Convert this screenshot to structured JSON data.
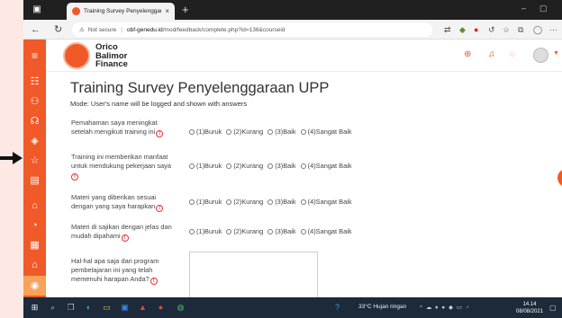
{
  "browser": {
    "tab_title": "Training Survey Penyelenggaraan",
    "tab_close": "×",
    "new_tab": "+",
    "security_label": "Not secure",
    "url_host": "obf-genedu.id",
    "url_path": "/mod/feedback/complete.php?id=136&courseid"
  },
  "site": {
    "logo_lines": [
      "Orico",
      "Balimor",
      "Finance"
    ]
  },
  "page": {
    "title": "Training Survey Penyelenggaraan UPP",
    "mode_note": "Mode: User's name will be logged and shown with answers"
  },
  "questions": [
    {
      "lines": [
        "Pemahaman saya meningkat",
        "setelah mengikuti training ini"
      ],
      "required": true
    },
    {
      "lines": [
        "Training ini memberikan manfaat",
        "untuk mendukung pekerjaan saya"
      ],
      "required": true
    },
    {
      "lines": [
        "Materi yang diberikan sesuai",
        "dengan yang saya harapkan"
      ],
      "required": true
    },
    {
      "lines": [
        "Materi di sajikan dengan jelas dan",
        "mudah dipahami"
      ],
      "required": true
    },
    {
      "lines": [
        "Hal-hal apa saja dari program",
        "pembelajaran ini yang telah",
        "memenuhi harapan Anda?"
      ],
      "required": true
    }
  ],
  "options": [
    "(1)Buruk",
    "(2)Kurang",
    "(3)Baik",
    "(4)Sangat Baik"
  ],
  "required_mark": "!",
  "taskbar": {
    "weather": "33°C  Hujan ringan",
    "time": "14.14",
    "date": "08/08/2021"
  },
  "colors": {
    "brand": "#f05a28",
    "nav_active": "#f8a35a"
  }
}
